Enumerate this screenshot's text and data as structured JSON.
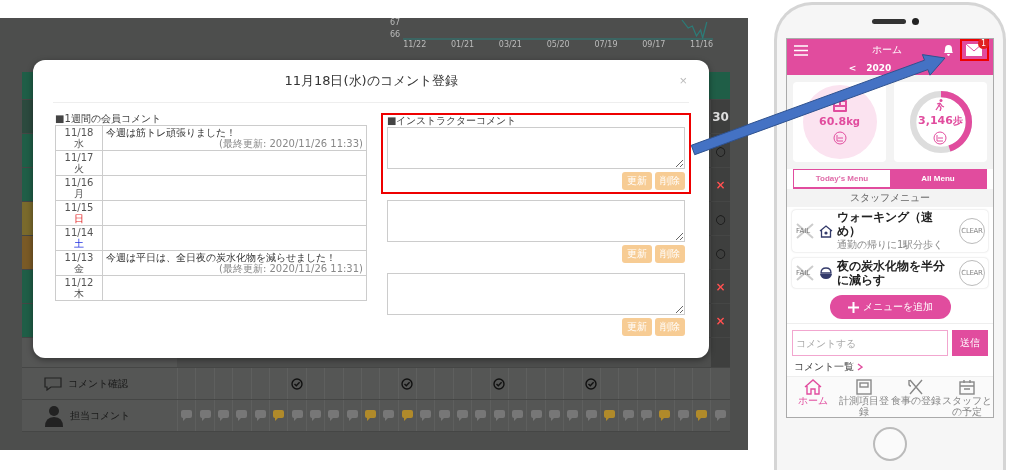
{
  "background_page": {
    "chart": {
      "y_ticks": [
        "67",
        "66"
      ],
      "x_ticks": [
        "11/22",
        "01/21",
        "03/21",
        "05/20",
        "07/19",
        "09/17",
        "11/16"
      ]
    },
    "rows": [
      {
        "kind": "header",
        "color": "#1f5e47"
      },
      {
        "kind": "count",
        "color": "#2c4a3e",
        "mark": "30"
      },
      {
        "kind": "ok",
        "color": "#1f5e47",
        "mark": "○"
      },
      {
        "kind": "ng",
        "color": "#1f5e47",
        "mark": "×"
      },
      {
        "kind": "ok",
        "color": "#7a6a2c",
        "mark": "○"
      },
      {
        "kind": "ok",
        "color": "#7a5a26",
        "mark": "○"
      },
      {
        "kind": "ng",
        "color": "#1f5e47",
        "mark": "×"
      },
      {
        "kind": "ng",
        "color": "#1f5e47",
        "mark": "×"
      },
      {
        "kind": "plain",
        "color": "#555655"
      }
    ],
    "comment_check": {
      "label": "コメント確認",
      "days": [
        false,
        false,
        false,
        false,
        false,
        false,
        true,
        false,
        false,
        false,
        false,
        false,
        true,
        false,
        false,
        false,
        false,
        true,
        false,
        false,
        false,
        false,
        true,
        false,
        false,
        false,
        false,
        false,
        false,
        false
      ]
    },
    "staff_comment": {
      "label": "担当コメント",
      "days": [
        false,
        false,
        false,
        false,
        false,
        true,
        false,
        false,
        false,
        false,
        true,
        false,
        true,
        false,
        false,
        false,
        false,
        false,
        false,
        false,
        false,
        false,
        false,
        true,
        false,
        false,
        true,
        false,
        true,
        false
      ]
    }
  },
  "modal": {
    "title": "11月18日(水)のコメント登録",
    "close": "×",
    "member_comments": {
      "heading": "■1週間の会員コメント",
      "rows": [
        {
          "date": "11/18",
          "weekday": "水",
          "kind": "weekday",
          "comment": "今週は筋トレ頑張りました！",
          "updated": "(最終更新: 2020/11/26 11:33)"
        },
        {
          "date": "11/17",
          "weekday": "火",
          "kind": "weekday"
        },
        {
          "date": "11/16",
          "weekday": "月",
          "kind": "weekday"
        },
        {
          "date": "11/15",
          "weekday": "日",
          "kind": "sunday"
        },
        {
          "date": "11/14",
          "weekday": "土",
          "kind": "saturday"
        },
        {
          "date": "11/13",
          "weekday": "金",
          "kind": "weekday",
          "comment": "今週は平日は、全日夜の炭水化物を減らせました！",
          "updated": "(最終更新: 2020/11/26 11:31)"
        },
        {
          "date": "11/12",
          "weekday": "木",
          "kind": "weekday"
        }
      ]
    },
    "instructor_comments": {
      "heading": "■インストラクターコメント",
      "entries": [
        {
          "highlighted": true,
          "buttons": [
            {
              "label": "更新",
              "disabled": true
            },
            {
              "label": "削除",
              "disabled": true
            }
          ]
        },
        {
          "highlighted": false,
          "buttons": [
            {
              "label": "更新",
              "disabled": true
            },
            {
              "label": "削除",
              "disabled": true
            }
          ]
        },
        {
          "highlighted": false,
          "buttons": [
            {
              "label": "更新",
              "disabled": true
            },
            {
              "label": "削除",
              "disabled": true
            }
          ]
        }
      ]
    }
  },
  "phone": {
    "header": {
      "title": "ホーム",
      "badge": "1",
      "mail_highlighted": true
    },
    "date": {
      "prev": "<",
      "text": "2020"
    },
    "weight": {
      "value": "60.8",
      "unit": "kg"
    },
    "steps": {
      "value": "3,146",
      "unit": "歩",
      "level": 0.45
    },
    "tabs": [
      {
        "label": "Today's Menu",
        "selected": false
      },
      {
        "label": "All Menu",
        "selected": true
      }
    ],
    "section": "スタッフメニュー",
    "menu": [
      {
        "kind": "walk",
        "title": "ウォーキング（速め）",
        "subtitle": "通勤の帰りに1駅分歩く",
        "fail": "FAIL",
        "clear": "CLEAR"
      },
      {
        "kind": "meal",
        "title": "夜の炭水化物を半分に減らす",
        "fail": "FAIL",
        "clear": "CLEAR"
      }
    ],
    "add_button": "メニューを追加",
    "comment": {
      "placeholder": "コメントする",
      "send": "送信"
    },
    "comment_list": "コメント一覧",
    "nav": [
      {
        "kind": "home",
        "label": "ホーム",
        "selected": true
      },
      {
        "kind": "scale",
        "label": "計測項目登録",
        "selected": false
      },
      {
        "kind": "meal",
        "label": "食事の登録",
        "selected": false
      },
      {
        "kind": "calendar",
        "label": "スタッフとの予定",
        "selected": false
      }
    ]
  }
}
